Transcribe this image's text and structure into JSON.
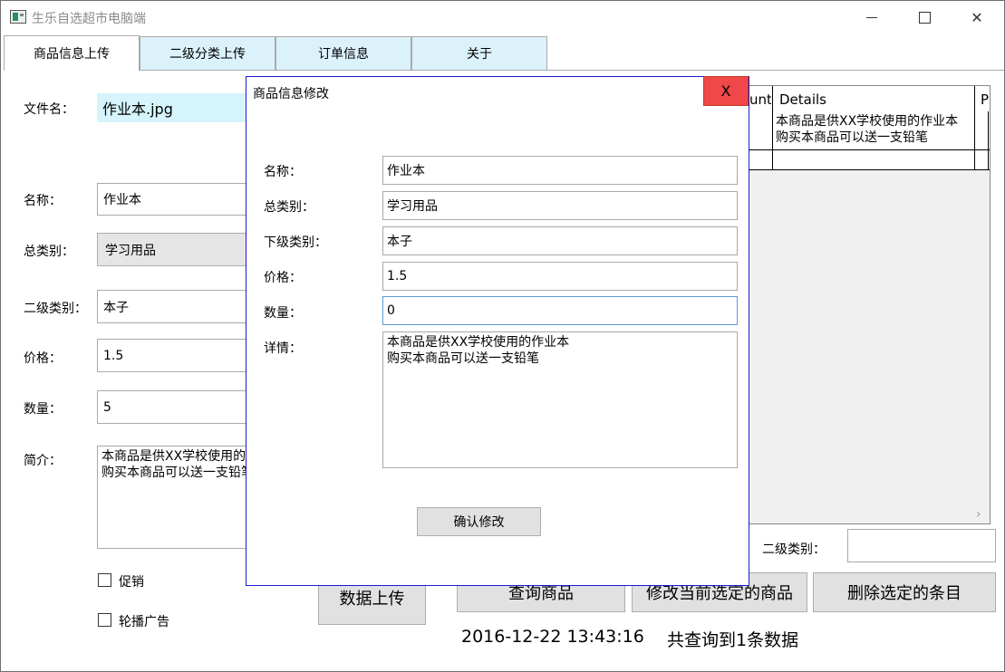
{
  "window": {
    "title": "生乐自选超市电脑端",
    "minimize": "minimize",
    "maximize": "maximize",
    "close_glyph": "✕"
  },
  "tabs": [
    {
      "label": "商品信息上传",
      "active": true
    },
    {
      "label": "二级分类上传",
      "active": false
    },
    {
      "label": "订单信息",
      "active": false
    },
    {
      "label": "关于",
      "active": false
    }
  ],
  "upload_form": {
    "filename_label": "文件名：",
    "filename_value": "作业本.jpg",
    "name_label": "名称：",
    "name_value": "作业本",
    "category_label": "总类别：",
    "category_value": "学习用品",
    "subcategory_label": "二级类别：",
    "subcategory_value": "本子",
    "price_label": "价格：",
    "price_value": "1.5",
    "quantity_label": "数量：",
    "quantity_value": "5",
    "intro_label": "简介：",
    "intro_value": "本商品是供XX学校使用的作业本\n购买本商品可以送一支铅笔",
    "promo_label": "促销",
    "carousel_label": "轮播广告",
    "upload_button": "数据上传"
  },
  "grid": {
    "columns": [
      "unt",
      "Details",
      "P"
    ],
    "rows": [
      {
        "details": "本商品是供XX学校使用的作业本\n购买本商品可以送一支铅笔"
      }
    ],
    "scroll_arrow": "›"
  },
  "query": {
    "subcategory_label": "二级类别：",
    "subcategory_value": "",
    "query_button": "查询商品",
    "modify_button": "修改当前选定的商品",
    "delete_button": "删除选定的条目",
    "timestamp": "2016-12-22 13:43:16",
    "result_text": "共查询到1条数据"
  },
  "modal": {
    "title": "商品信息修改",
    "close_label": "X",
    "name_label": "名称：",
    "name_value": "作业本",
    "category_label": "总类别：",
    "category_value": "学习用品",
    "subcategory_label": "下级类别：",
    "subcategory_value": "本子",
    "price_label": "价格：",
    "price_value": "1.5",
    "quantity_label": "数量：",
    "quantity_value": "0",
    "details_label": "详情：",
    "details_value": "本商品是供XX学校使用的作业本\n购买本商品可以送一支铅笔",
    "confirm_button": "确认修改"
  },
  "colors": {
    "tab_bg": "#dbf2fb",
    "filename_bg": "#d5f4fb",
    "modal_border": "#1a1ad0",
    "close_red": "#f04848"
  }
}
